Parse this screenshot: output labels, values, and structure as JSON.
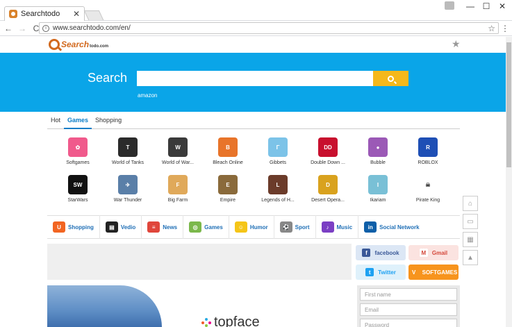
{
  "browser": {
    "tab_title": "Searchtodo",
    "tab_close": "✕",
    "url": "www.searchtodo.com/en/",
    "controls": {
      "minimize": "—",
      "maximize": "☐",
      "close": "✕"
    },
    "nav": {
      "back": "←",
      "forward": "→",
      "reload": "C"
    }
  },
  "header": {
    "logo_word": "Search",
    "logo_domain": "todo.com"
  },
  "hero": {
    "title": "Search",
    "search_value": "",
    "hint": "amazon",
    "colors": {
      "background": "#0aa5e8",
      "button": "#f5b81b"
    }
  },
  "category_tabs": [
    {
      "label": "Hot",
      "active": false
    },
    {
      "label": "Games",
      "active": true
    },
    {
      "label": "Shopping",
      "active": false
    }
  ],
  "games": [
    {
      "label": "Softgames",
      "icon": "softgames-icon",
      "color": "#f05a8c",
      "glyph": "✿"
    },
    {
      "label": "World of Tanks",
      "icon": "tanks-icon",
      "color": "#2b2b2b",
      "glyph": "T"
    },
    {
      "label": "World of War...",
      "icon": "warships-icon",
      "color": "#3a3a3a",
      "glyph": "W"
    },
    {
      "label": "Bleach Online",
      "icon": "bleach-icon",
      "color": "#e8742a",
      "glyph": "B"
    },
    {
      "label": "Gibbets",
      "icon": "gibbets-icon",
      "color": "#7cc3e8",
      "glyph": "Γ"
    },
    {
      "label": "Double Down ...",
      "icon": "doubledown-icon",
      "color": "#c8102e",
      "glyph": "DD"
    },
    {
      "label": "Bubble",
      "icon": "bubble-icon",
      "color": "#9b59b6",
      "glyph": "●"
    },
    {
      "label": "ROBLOX",
      "icon": "roblox-icon",
      "color": "#1e4fb5",
      "glyph": "R"
    },
    {
      "label": "StarWars",
      "icon": "starwars-icon",
      "color": "#111111",
      "glyph": "SW"
    },
    {
      "label": "War Thunder",
      "icon": "warthunder-icon",
      "color": "#5a7fa8",
      "glyph": "✈"
    },
    {
      "label": "Big Farm",
      "icon": "bigfarm-icon",
      "color": "#e0a95a",
      "glyph": "F"
    },
    {
      "label": "Empire",
      "icon": "empire-icon",
      "color": "#8a6a3b",
      "glyph": "E"
    },
    {
      "label": "Legends of H...",
      "icon": "legends-icon",
      "color": "#6b3b2a",
      "glyph": "L"
    },
    {
      "label": "Desert Opera...",
      "icon": "desert-icon",
      "color": "#d9a21e",
      "glyph": "D"
    },
    {
      "label": "Ikariam",
      "icon": "ikariam-icon",
      "color": "#79c0d6",
      "glyph": "I"
    },
    {
      "label": "Pirate King",
      "icon": "pirate-icon",
      "color": "#ffffff",
      "glyph": "☠"
    }
  ],
  "quick_links": [
    {
      "label": "Shopping",
      "icon": "shopping-bag-icon",
      "color": "#f26522",
      "glyph": "U"
    },
    {
      "label": "Vedio",
      "icon": "clapper-icon",
      "color": "#222222",
      "glyph": "▤"
    },
    {
      "label": "News",
      "icon": "news-icon",
      "color": "#e0463b",
      "glyph": "≡"
    },
    {
      "label": "Games",
      "icon": "gamepad-icon",
      "color": "#7bb84b",
      "glyph": "◎"
    },
    {
      "label": "Humor",
      "icon": "smiley-icon",
      "color": "#f5c518",
      "glyph": "☺"
    },
    {
      "label": "Sport",
      "icon": "soccer-ball-icon",
      "color": "#888888",
      "glyph": "⚽"
    },
    {
      "label": "Music",
      "icon": "music-icon",
      "color": "#7b3fc4",
      "glyph": "♪"
    },
    {
      "label": "Social Network",
      "icon": "linkedin-icon",
      "color": "#0e5fa8",
      "glyph": "in"
    }
  ],
  "social_buttons": [
    {
      "label": "facebook",
      "icon": "facebook-icon",
      "bg": "#dce7f5",
      "fg": "#3b5998",
      "sq": "#3b5998",
      "glyph": "f"
    },
    {
      "label": "Gmail",
      "icon": "gmail-icon",
      "bg": "#fbe3e0",
      "fg": "#d44638",
      "sq": "#ffffff",
      "glyph": "M"
    },
    {
      "label": "Twitter",
      "icon": "twitter-icon",
      "bg": "#dff1fb",
      "fg": "#1da1f2",
      "sq": "#1da1f2",
      "glyph": "t"
    },
    {
      "label": "SOFTGAMES",
      "icon": "softgames-logo-icon",
      "bg": "#f7941d",
      "fg": "#ffffff",
      "sq": "#f7941d",
      "glyph": "V"
    }
  ],
  "banner": {
    "brand": "topface"
  },
  "signup": {
    "first_name": "First name",
    "email": "Email",
    "password": "Password"
  }
}
